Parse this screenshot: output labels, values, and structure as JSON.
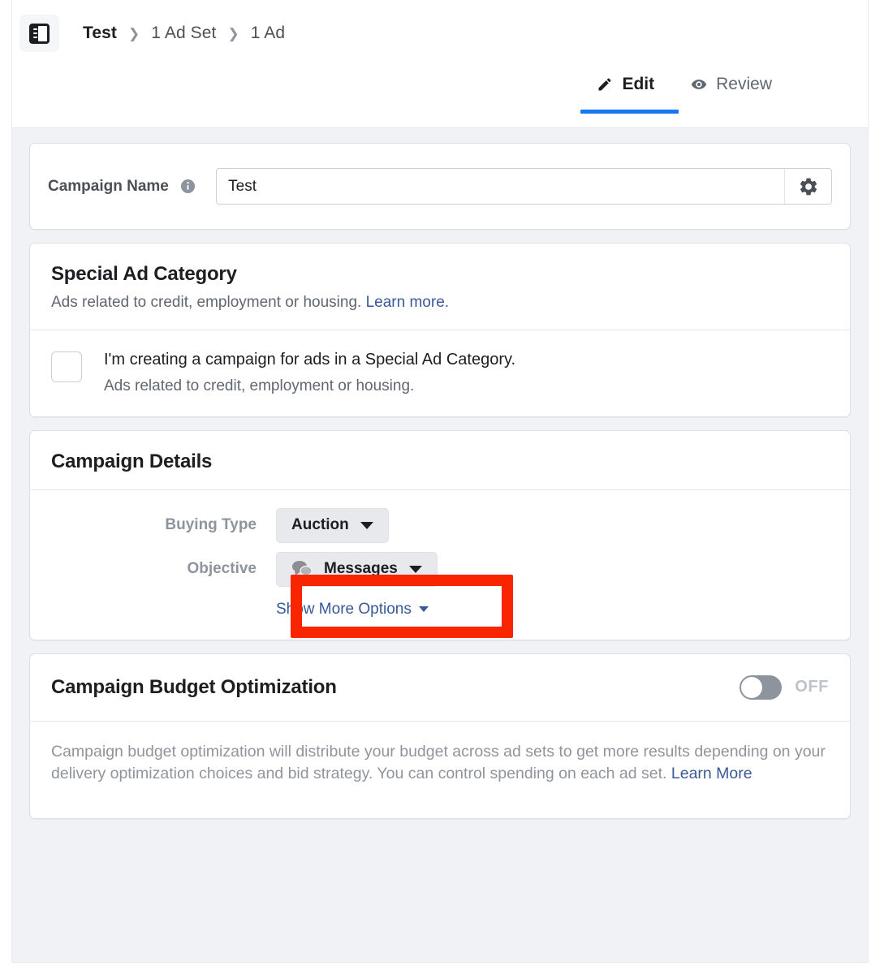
{
  "header": {
    "panel_toggle_icon": "sidebar-panel-icon",
    "breadcrumbs": [
      {
        "label": "Test",
        "active": true
      },
      {
        "label": "1 Ad Set",
        "active": false
      },
      {
        "label": "1 Ad",
        "active": false
      }
    ],
    "separator": "›",
    "tabs": [
      {
        "label": "Edit",
        "icon": "pencil-icon",
        "active": true
      },
      {
        "label": "Review",
        "icon": "eye-icon",
        "active": false
      }
    ],
    "active_tab_color": "#1877f2"
  },
  "campaign_name": {
    "label": "Campaign Name",
    "info_icon": "info-icon",
    "value": "Test",
    "placeholder": "Campaign Name",
    "gear_icon": "gear-icon"
  },
  "special_ad_category": {
    "title": "Special Ad Category",
    "subtitle": "Ads related to credit, employment or housing.",
    "learn_more": "Learn more.",
    "checkbox_checked": false,
    "checkbox_title": "I'm creating a campaign for ads in a Special Ad Category.",
    "checkbox_desc": "Ads related to credit, employment or housing."
  },
  "campaign_details": {
    "title": "Campaign Details",
    "buying_type": {
      "label": "Buying Type",
      "value": "Auction",
      "caret_icon": "chevron-down-icon"
    },
    "objective": {
      "label": "Objective",
      "value": "Messages",
      "icon": "messages-bubbles-icon",
      "caret_icon": "chevron-down-icon"
    },
    "show_more": {
      "label": "Show More Options",
      "caret_icon": "chevron-down-icon"
    },
    "highlight_color": "#f92400"
  },
  "campaign_budget_optimization": {
    "title": "Campaign Budget Optimization",
    "toggle_state": "OFF",
    "toggle_on": false,
    "description": "Campaign budget optimization will distribute your budget across ad sets to get more results depending on your delivery optimization choices and bid strategy. You can control spending on each ad set.",
    "learn_more": "Learn More"
  }
}
